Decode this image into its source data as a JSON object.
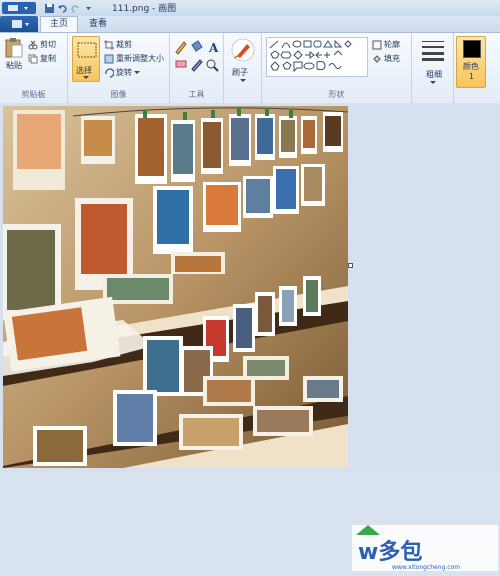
{
  "window": {
    "title": "111.png - 画图"
  },
  "tabs": [
    {
      "label": "主页"
    },
    {
      "label": "查看"
    }
  ],
  "clipboard": {
    "paste": "粘贴",
    "cut": "剪切",
    "copy": "复制",
    "group": "剪贴板"
  },
  "image": {
    "select": "选择",
    "crop": "裁剪",
    "resize": "重新调整大小",
    "rotate": "旋转",
    "group": "图像"
  },
  "tools": {
    "group": "工具"
  },
  "brushes": {
    "label": "刷子"
  },
  "shapes": {
    "outline": "轮廓",
    "fill": "填充",
    "group": "形状"
  },
  "size": {
    "label": "粗细"
  },
  "color": {
    "label1": "颜色",
    "label2": "1",
    "value": "#000000"
  },
  "watermark": {
    "brand": "w多包",
    "url": "www.xitongcheng.com"
  }
}
